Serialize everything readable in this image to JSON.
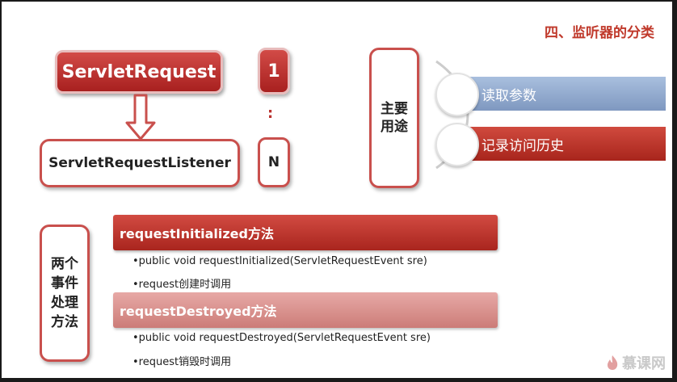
{
  "title": "四、监听器的分类",
  "left": {
    "request_label": "ServletRequest",
    "listener_label": "ServletRequestListener",
    "count_one": "1",
    "colon": ":",
    "count_n": "N"
  },
  "usage": {
    "label_line1": "主要",
    "label_line2": "用途",
    "items": [
      "读取参数",
      "记录访问历史"
    ]
  },
  "events": {
    "label_line1": "两个",
    "label_line2": "事件",
    "label_line3": "处理",
    "label_line4": "方法",
    "init_header": "requestInitialized方法",
    "init_lines": [
      "•public void requestInitialized(ServletRequestEvent sre)",
      "•request创建时调用"
    ],
    "destroy_header": "requestDestroyed方法",
    "destroy_lines": [
      "•public void requestDestroyed(ServletRequestEvent  sre)",
      "•request销毁时调用"
    ]
  },
  "logo": {
    "text": "慕课网",
    "icon": "flame-icon"
  },
  "colors": {
    "accent": "#b9312e",
    "blue_bar": "#8fa7cc",
    "red_bar": "#bb3328",
    "pink_header": "#d98e8a"
  }
}
